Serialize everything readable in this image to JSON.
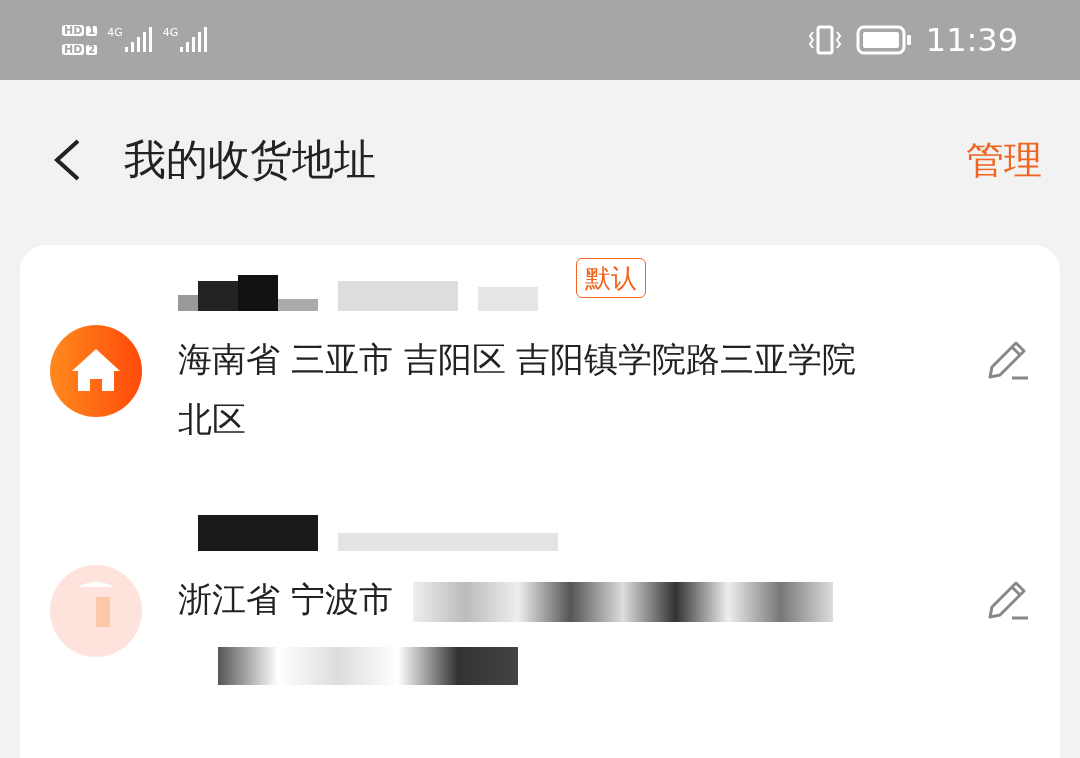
{
  "status_bar": {
    "sims": [
      {
        "label": "HD",
        "slot": "1"
      },
      {
        "label": "HD",
        "slot": "2"
      }
    ],
    "networks": [
      "4G",
      "4G"
    ],
    "time": "11:39"
  },
  "header": {
    "title": "我的收货地址",
    "action": "管理"
  },
  "addresses": [
    {
      "kind": "home",
      "default": true,
      "default_label": "默认",
      "address": "海南省 三亚市 吉阳区 吉阳镇学院路三亚学院北区",
      "redacted_tail": false
    },
    {
      "kind": "blurred",
      "default": false,
      "address": "浙江省 宁波市",
      "redacted_tail": true
    }
  ]
}
